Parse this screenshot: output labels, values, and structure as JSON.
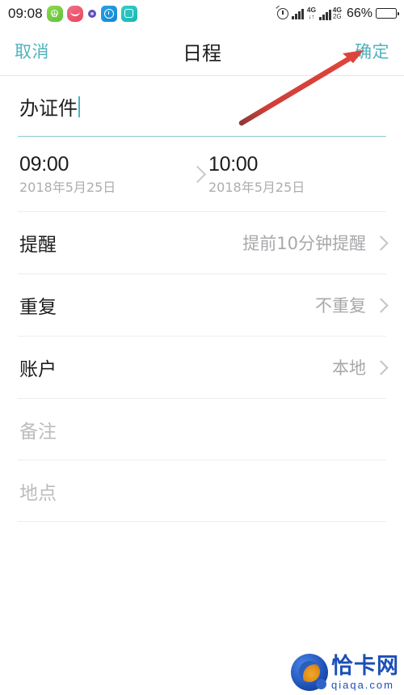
{
  "statusbar": {
    "time": "09:08",
    "icons_left": [
      "shield-security-icon",
      "face-smile-icon",
      "purple-dot-icon",
      "clock-app-icon",
      "scan-app-icon"
    ],
    "alarm_icon": "alarm-clock-icon",
    "signal_icon": "signal-bars-icon",
    "network1_up": "4G",
    "network1_down": "↓↑",
    "network2_up": "4G",
    "network2_down": "2G",
    "battery_percent": "66%",
    "battery_level": 66
  },
  "navbar": {
    "cancel_label": "取消",
    "title": "日程",
    "confirm_label": "确定",
    "accent_color": "#4fb3bf"
  },
  "form": {
    "title_value": "办证件",
    "start": {
      "time": "09:00",
      "date": "2018年5月25日"
    },
    "end": {
      "time": "10:00",
      "date": "2018年5月25日"
    },
    "range_separator_icon": "chevron-right-icon",
    "options": [
      {
        "label": "提醒",
        "value": "提前10分钟提醒",
        "chevron": "chevron-right-icon"
      },
      {
        "label": "重复",
        "value": "不重复",
        "chevron": "chevron-right-icon"
      },
      {
        "label": "账户",
        "value": "本地",
        "chevron": "chevron-right-icon"
      }
    ],
    "placeholders": [
      {
        "text": "备注"
      },
      {
        "text": "地点"
      }
    ]
  },
  "annotation": {
    "arrow_color": "#d93b36",
    "points_to": "确定"
  },
  "watermark": {
    "cn": "恰卡网",
    "en": "qiaqa.com",
    "color": "#1c4fb5"
  }
}
